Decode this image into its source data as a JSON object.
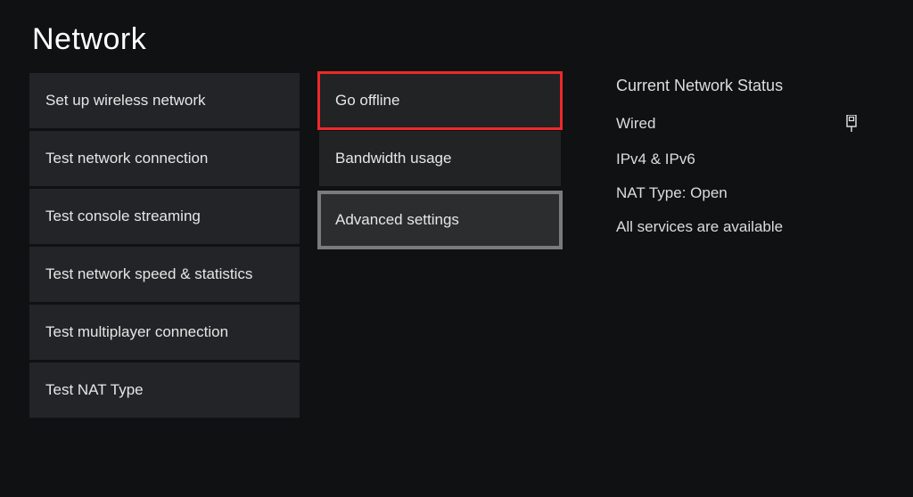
{
  "title": "Network",
  "left": {
    "items": [
      "Set up wireless network",
      "Test network connection",
      "Test console streaming",
      "Test network speed & statistics",
      "Test multiplayer connection",
      "Test NAT Type"
    ]
  },
  "mid": {
    "go_offline": "Go offline",
    "bandwidth": "Bandwidth usage",
    "advanced": "Advanced settings"
  },
  "status": {
    "title": "Current Network Status",
    "connection_type": "Wired",
    "ip": "IPv4 & IPv6",
    "nat": "NAT Type: Open",
    "services": "All services are available"
  }
}
